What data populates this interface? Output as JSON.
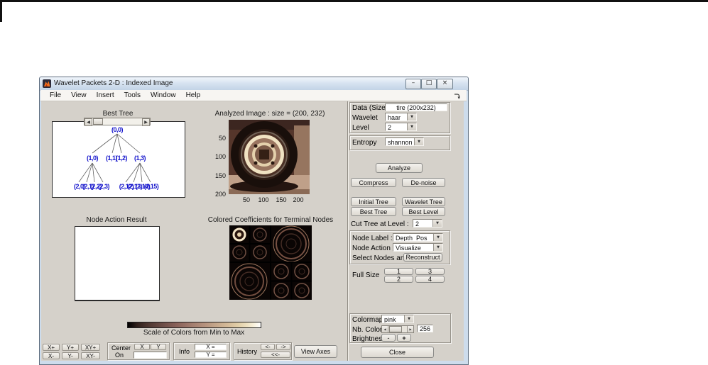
{
  "window": {
    "title": "Wavelet Packets 2-D : Indexed Image",
    "menu": [
      "File",
      "View",
      "Insert",
      "Tools",
      "Window",
      "Help"
    ],
    "controls": {
      "minimize": "–",
      "maximize": "□",
      "close": "×"
    }
  },
  "icons": {
    "dropdown_arrow": "▼",
    "scroll_left": "◀",
    "scroll_right": "▶"
  },
  "tree": {
    "title": "Best Tree",
    "root": "(0,0)",
    "level1": [
      "(1,0)",
      "(1,1)",
      "(1,2)",
      "(1,3)"
    ],
    "level2_left": [
      "(2,0)",
      "(2,1)",
      "(2,2)",
      "(2,3)"
    ],
    "level2_right": [
      "(2,12)",
      "(2,13)",
      "(2,14)",
      "(2,15)"
    ]
  },
  "analyzed": {
    "title": "Analyzed Image : size = (200, 232)",
    "x_ticks": [
      "50",
      "100",
      "150",
      "200"
    ],
    "y_ticks": [
      "50",
      "100",
      "150",
      "200"
    ]
  },
  "node_action": {
    "title": "Node Action Result"
  },
  "coefficients": {
    "title": "Colored Coefficients for Terminal Nodes"
  },
  "colorbar": {
    "label": "Scale of Colors from Min to Max"
  },
  "toolbar": {
    "x_plus": "X+",
    "y_plus": "Y+",
    "xy_plus": "XY+",
    "x_minus": "X-",
    "y_minus": "Y-",
    "xy_minus": "XY-",
    "center_line1": "Center",
    "center_line2": "On",
    "x_button": "X",
    "y_button": "Y",
    "info_label": "Info",
    "x_value": "X =",
    "y_value": "Y =",
    "history_label": "History",
    "back": "<-",
    "forward": "->",
    "far_back": "<<-",
    "view_axes": "View Axes"
  },
  "panel": {
    "data_label": "Data (Size)",
    "data_value": "tire (200x232)",
    "wavelet_label": "Wavelet",
    "wavelet_value": "haar",
    "level_label": "Level",
    "level_value": "2",
    "entropy_label": "Entropy",
    "entropy_value": "shannon",
    "analyze": "Analyze",
    "compress": "Compress",
    "denoise": "De-noise",
    "initial_tree": "Initial Tree",
    "wavelet_tree": "Wavelet Tree",
    "best_tree": "Best Tree",
    "best_level": "Best Level",
    "cut_label": "Cut Tree at Level :",
    "cut_value": "2",
    "node_label": "Node Label :",
    "node_label_value": "Depth_Pos",
    "node_action": "Node Action :",
    "node_action_value": "Visualize",
    "select_label": "Select Nodes and",
    "reconstruct": "Reconstruct",
    "full_size": "Full Size",
    "fs_buttons": [
      "1",
      "3",
      "2",
      "4"
    ],
    "colormap_label": "Colormap",
    "colormap_value": "pink",
    "nb_colors_label": "Nb. Colors",
    "nb_colors_value": "256",
    "brightness_label": "Brightness",
    "brightness_minus": "-",
    "brightness_plus": "+",
    "close": "Close"
  }
}
